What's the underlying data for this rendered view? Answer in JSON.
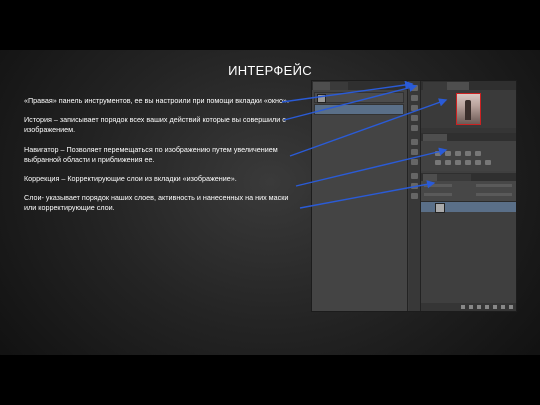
{
  "title": "ИНТЕРФЕЙС",
  "paragraphs": [
    "«Правая» панель инструментов, ее вы настроили при помощи вкладки «окно».",
    "История – записывает порядок всех ваших действий которые вы совершили с изображением.",
    "Навигатор – Позволяет перемещаться по изображению путем увеличением выбранной области и приближения ее.",
    "Коррекция – Корректирующие слои из вкладки «изображение».",
    "Слои- указывает порядок наших слоев, активность и нанесенных на них маски или корректирующие слои."
  ],
  "colors": {
    "background_dark": "#242424",
    "band": "#000000",
    "text": "#ffffff",
    "arrow": "#2a5bd7",
    "selection": "#5a6f88"
  }
}
